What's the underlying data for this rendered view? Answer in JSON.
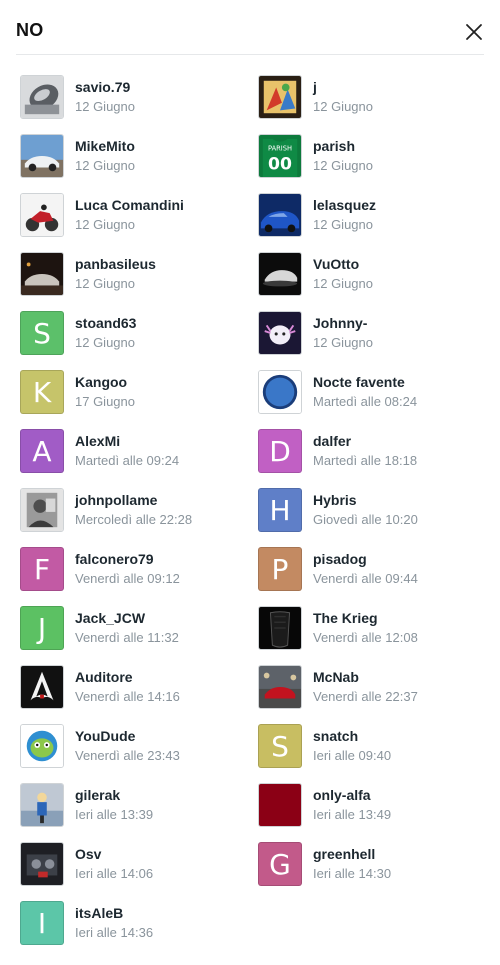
{
  "dialog": {
    "title": "NO",
    "close_icon": "close-icon"
  },
  "voters": [
    {
      "name": "savio.79",
      "date": "12 Giugno",
      "avatar": {
        "type": "photo",
        "scene": "silver-object"
      }
    },
    {
      "name": "j",
      "date": "12 Giugno",
      "avatar": {
        "type": "photo",
        "scene": "colorful-art"
      }
    },
    {
      "name": "MikeMito",
      "date": "12 Giugno",
      "avatar": {
        "type": "photo",
        "scene": "white-car-sky"
      }
    },
    {
      "name": "parish",
      "date": "12 Giugno",
      "avatar": {
        "type": "photo",
        "scene": "green-jersey",
        "jersey_text": "PARISH",
        "jersey_number": "00"
      }
    },
    {
      "name": "Luca Comandini",
      "date": "12 Giugno",
      "avatar": {
        "type": "photo",
        "scene": "red-motorbike"
      }
    },
    {
      "name": "lelasquez",
      "date": "12 Giugno",
      "avatar": {
        "type": "photo",
        "scene": "blue-car"
      }
    },
    {
      "name": "panbasileus",
      "date": "12 Giugno",
      "avatar": {
        "type": "photo",
        "scene": "dark-car-night"
      }
    },
    {
      "name": "VuOtto",
      "date": "12 Giugno",
      "avatar": {
        "type": "photo",
        "scene": "dark-car-studio"
      }
    },
    {
      "name": "stoand63",
      "date": "12 Giugno",
      "avatar": {
        "type": "letter",
        "letter": "S",
        "color": "#5cc06a"
      }
    },
    {
      "name": "Johnny-",
      "date": "12 Giugno",
      "avatar": {
        "type": "photo",
        "scene": "axolotl"
      }
    },
    {
      "name": "Kangoo",
      "date": "17 Giugno",
      "avatar": {
        "type": "letter",
        "letter": "K",
        "color": "#c6c46a"
      }
    },
    {
      "name": "Nocte favente",
      "date": "Martedì alle 08:24",
      "avatar": {
        "type": "photo",
        "scene": "moon-emblem"
      }
    },
    {
      "name": "AlexMi",
      "date": "Martedì alle 09:24",
      "avatar": {
        "type": "letter",
        "letter": "A",
        "color": "#a15cc6"
      }
    },
    {
      "name": "dalfer",
      "date": "Martedì alle 18:18",
      "avatar": {
        "type": "letter",
        "letter": "D",
        "color": "#c160c4"
      }
    },
    {
      "name": "johnpollame",
      "date": "Mercoledì alle 22:28",
      "avatar": {
        "type": "photo",
        "scene": "bw-portrait"
      }
    },
    {
      "name": "Hybris",
      "date": "Giovedì alle 10:20",
      "avatar": {
        "type": "letter",
        "letter": "H",
        "color": "#5f7fc8"
      }
    },
    {
      "name": "falconero79",
      "date": "Venerdì alle 09:12",
      "avatar": {
        "type": "letter",
        "letter": "F",
        "color": "#c25aa4"
      }
    },
    {
      "name": "pisadog",
      "date": "Venerdì alle 09:44",
      "avatar": {
        "type": "letter",
        "letter": "P",
        "color": "#c38a62"
      }
    },
    {
      "name": "Jack_JCW",
      "date": "Venerdì alle 11:32",
      "avatar": {
        "type": "letter",
        "letter": "J",
        "color": "#5cc163"
      }
    },
    {
      "name": "The Krieg",
      "date": "Venerdì alle 12:08",
      "avatar": {
        "type": "photo",
        "scene": "black-grille"
      }
    },
    {
      "name": "Auditore",
      "date": "Venerdì alle 14:16",
      "avatar": {
        "type": "photo",
        "scene": "assassin-logo"
      }
    },
    {
      "name": "McNab",
      "date": "Venerdì alle 22:37",
      "avatar": {
        "type": "photo",
        "scene": "red-car-crowd"
      }
    },
    {
      "name": "YouDude",
      "date": "Venerdì alle 23:43",
      "avatar": {
        "type": "photo",
        "scene": "cartoon-blob"
      }
    },
    {
      "name": "snatch",
      "date": "Ieri alle 09:40",
      "avatar": {
        "type": "letter",
        "letter": "S",
        "color": "#c8be62"
      }
    },
    {
      "name": "gilerak",
      "date": "Ieri alle 13:39",
      "avatar": {
        "type": "photo",
        "scene": "figure-blue"
      }
    },
    {
      "name": "only-alfa",
      "date": "Ieri alle 13:49",
      "avatar": {
        "type": "solid",
        "color": "#8b0015"
      }
    },
    {
      "name": "Osv",
      "date": "Ieri alle 14:06",
      "avatar": {
        "type": "photo",
        "scene": "engine-bay"
      }
    },
    {
      "name": "greenhell",
      "date": "Ieri alle 14:30",
      "avatar": {
        "type": "letter",
        "letter": "G",
        "color": "#c25a8a"
      }
    },
    {
      "name": "itsAleB",
      "date": "Ieri alle 14:36",
      "avatar": {
        "type": "letter",
        "letter": "I",
        "color": "#5cc6a8"
      }
    }
  ]
}
